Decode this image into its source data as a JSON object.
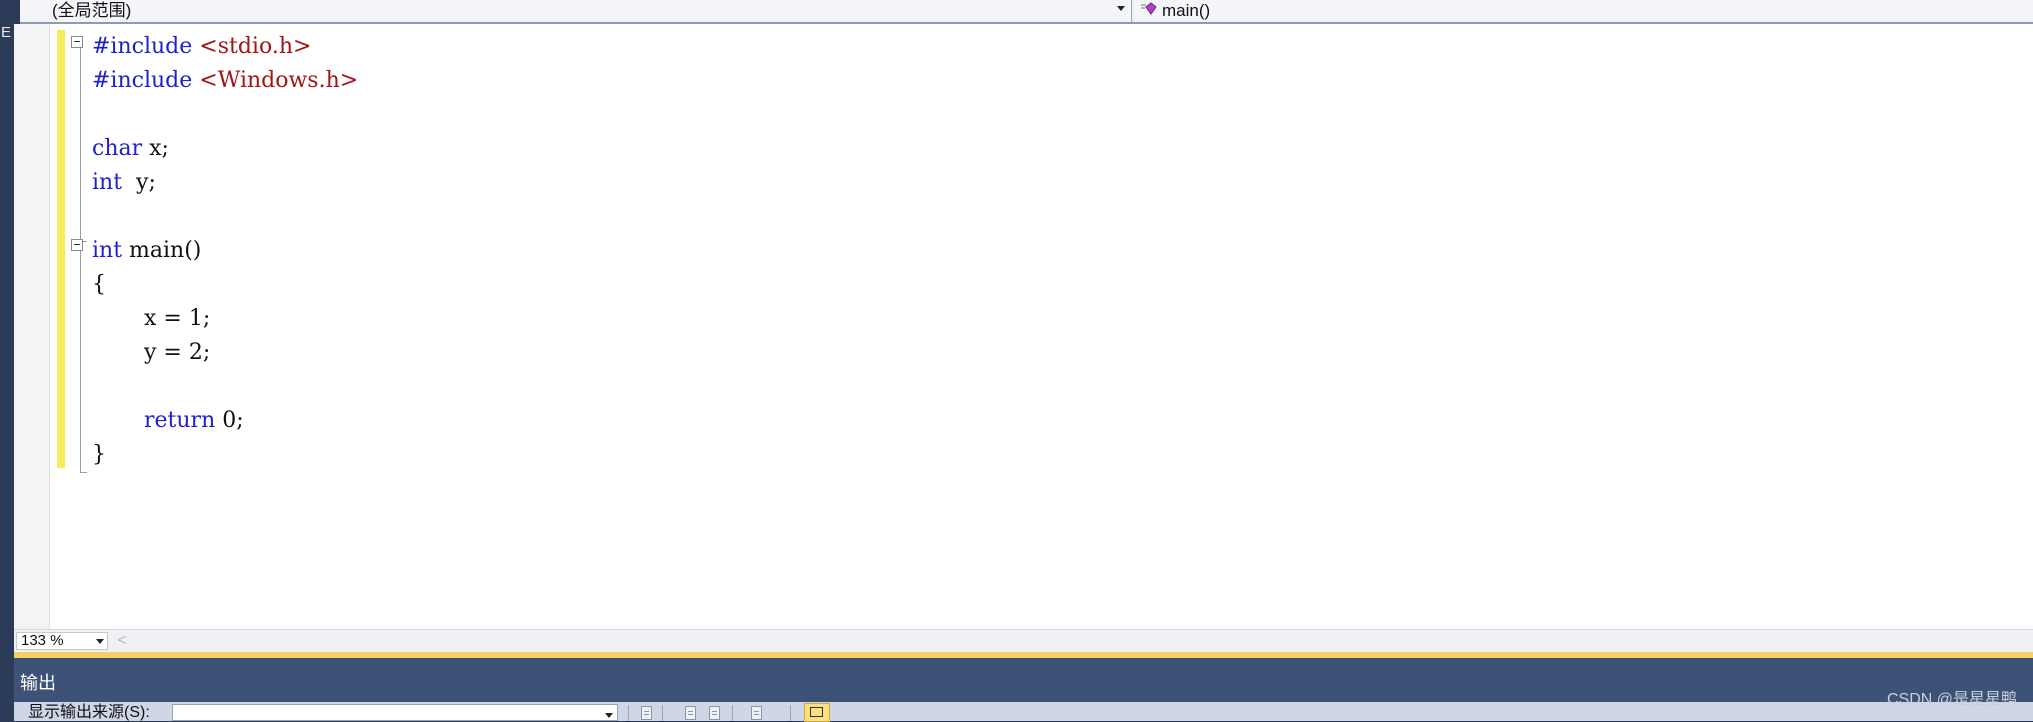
{
  "frame": {
    "left_glyph": "E"
  },
  "navbar": {
    "scope": "(全局范围)",
    "member": "main()",
    "member_icon": "method-icon"
  },
  "code": {
    "line1": {
      "pp": "#include",
      "hdr": "<stdio.h>"
    },
    "line2": {
      "pp": "#include",
      "hdr": "<Windows.h>"
    },
    "line4": {
      "kw": "char",
      "rest": " x;"
    },
    "line5": {
      "kw": "int",
      "rest": "  y;"
    },
    "line7": {
      "kw": "int",
      "rest": " main()"
    },
    "line8": "{",
    "line9": "x = 1;",
    "line10": "y = 2;",
    "line12": {
      "kw": "return",
      "rest": " 0;"
    },
    "line13": "}"
  },
  "zoom": {
    "value": "133 %",
    "scroll_left_glyph": "<"
  },
  "output": {
    "title": "输出",
    "source_label": "显示输出来源(S):",
    "source_value": ""
  },
  "watermark": "CSDN @是星星鸭",
  "colors": {
    "keyword": "#1f1fcf",
    "header_string": "#a31515",
    "change_bar": "#f7ec5c",
    "panel_header": "#3d5277"
  }
}
